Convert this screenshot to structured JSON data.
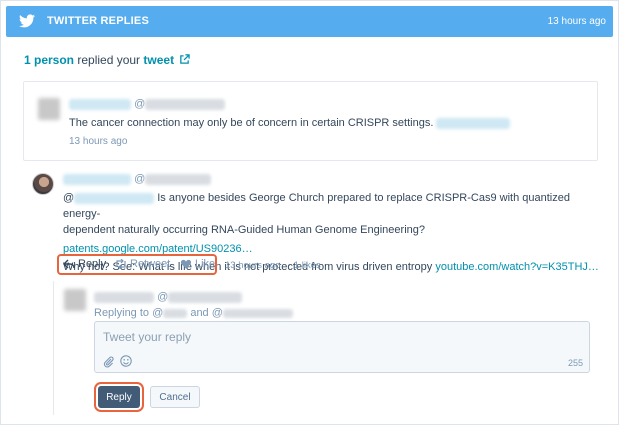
{
  "header": {
    "title": "TWITTER REPLIES",
    "time": "13 hours ago",
    "icon": "twitter-bird-icon",
    "bg_color": "#55acee"
  },
  "summary": {
    "count_text": "1 person",
    "middle_text": " replied your ",
    "link_text": "tweet",
    "icon": "external-link-icon"
  },
  "original_tweet": {
    "at": "@",
    "text": "The cancer connection may only be of concern in certain CRISPR settings.",
    "time": "13 hours ago"
  },
  "reply": {
    "at": "@",
    "mention_at": "@",
    "line1": "Is anyone besides George Church prepared to replace CRISPR-Cas9 with quantized energy-",
    "line2": "dependent naturally occurring RNA-Guided Human Genome Engineering?",
    "link1": "patents.google.com/patent/US90236…",
    "line3": "Why not? See: What is life when it is not protected from virus driven entropy ",
    "link2": "youtube.com/watch?v=K35THJ…",
    "actions": {
      "reply": "Reply",
      "retweet": "Retweet",
      "like": "Like"
    },
    "time": "13 hours ago",
    "likes": "· 1 likes",
    "highlight_color": "#e8643d"
  },
  "composer": {
    "at": "@",
    "replying_prefix": "Replying to @",
    "replying_and": " and @",
    "placeholder": "Tweet your reply",
    "char_count": "255",
    "reply_button": "Reply",
    "cancel_button": "Cancel"
  }
}
